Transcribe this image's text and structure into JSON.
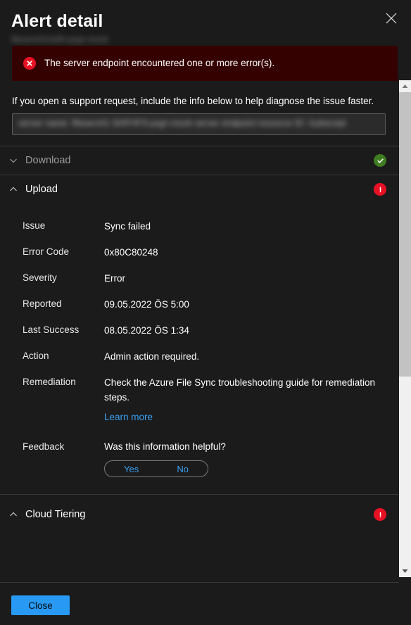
{
  "panel": {
    "title": "Alert detail",
    "subtitle_redacted": "fileserv01\\shfh-prgn-mock",
    "close_icon": "close-icon",
    "accent_blue": "#2899f5",
    "link_blue": "#3aa0f3",
    "error_red": "#e81123",
    "ok_green": "#3f7d20",
    "banner_bg": "#350000"
  },
  "banner": {
    "icon": "error-circle-icon",
    "message": "The server endpoint encountered one or more error(s)."
  },
  "support": {
    "text": "If you open a support request, include the info below to help diagnose the issue faster.",
    "field_value_redacted": "server name: fileserv01-SHFHFS-prgn-mock  server endpoint resource ID: /subscript"
  },
  "sections": [
    {
      "name": "download",
      "label": "Download",
      "expanded": false,
      "chevron": "chevron-down-icon",
      "status_icon": "success-circle-icon",
      "status": "ok"
    },
    {
      "name": "upload",
      "label": "Upload",
      "expanded": true,
      "chevron": "chevron-up-icon",
      "status_icon": "error-circle-icon",
      "status": "error",
      "rows": [
        {
          "label": "Issue",
          "value": "Sync failed"
        },
        {
          "label": "Error Code",
          "value": "0x80C80248"
        },
        {
          "label": "Severity",
          "value": "Error"
        },
        {
          "label": "Reported",
          "value": "09.05.2022 ÖS 5:00"
        },
        {
          "label": "Last Success",
          "value": "08.05.2022 ÖS 1:34"
        },
        {
          "label": "Action",
          "value": "Admin action required."
        }
      ],
      "remediation": {
        "label": "Remediation",
        "value": "Check the Azure File Sync troubleshooting guide for remediation steps.",
        "link": "Learn more"
      },
      "feedback": {
        "label": "Feedback",
        "question": "Was this information helpful?",
        "yes": "Yes",
        "no": "No"
      }
    },
    {
      "name": "cloud-tiering",
      "label": "Cloud Tiering",
      "expanded": true,
      "chevron": "chevron-up-icon",
      "status_icon": "error-circle-icon",
      "status": "error"
    }
  ],
  "footer": {
    "close_label": "Close"
  },
  "scrollbar": {
    "up_icon": "scroll-up-arrow-icon",
    "down_icon": "scroll-down-arrow-icon"
  }
}
